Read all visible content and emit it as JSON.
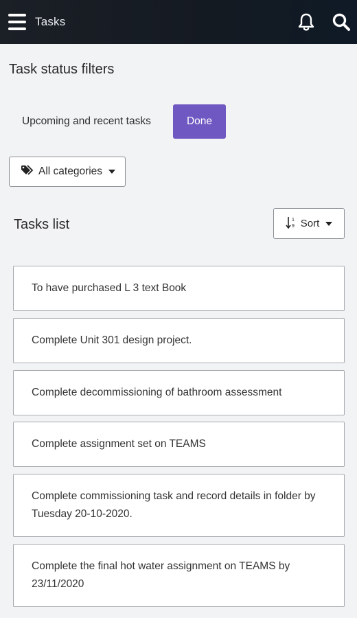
{
  "header": {
    "title": "Tasks",
    "menu_icon": "hamburger-menu-icon",
    "notifications_icon": "bell-icon",
    "search_icon": "search-icon",
    "background": "#141a22"
  },
  "filters": {
    "heading": "Task status filters",
    "tabs": [
      {
        "label": "Upcoming and recent tasks",
        "active": false
      },
      {
        "label": "Done",
        "active": true
      }
    ],
    "active_color": "#6f58c2",
    "category_dropdown": {
      "label": "All categories",
      "icon": "tags-icon"
    }
  },
  "list": {
    "heading": "Tasks list",
    "sort": {
      "label": "Sort",
      "icon": "sort-numeric-icon"
    },
    "tasks": [
      {
        "text": "To have purchased L 3 text Book"
      },
      {
        "text": "Complete Unit 301 design project."
      },
      {
        "text": "Complete decommissioning of bathroom assessment"
      },
      {
        "text": "Complete assignment set on TEAMS"
      },
      {
        "text": "Complete commissioning task and record details in folder by Tuesday 20-10-2020."
      },
      {
        "text": "Complete the final hot water assignment on TEAMS by 23/11/2020"
      }
    ]
  }
}
